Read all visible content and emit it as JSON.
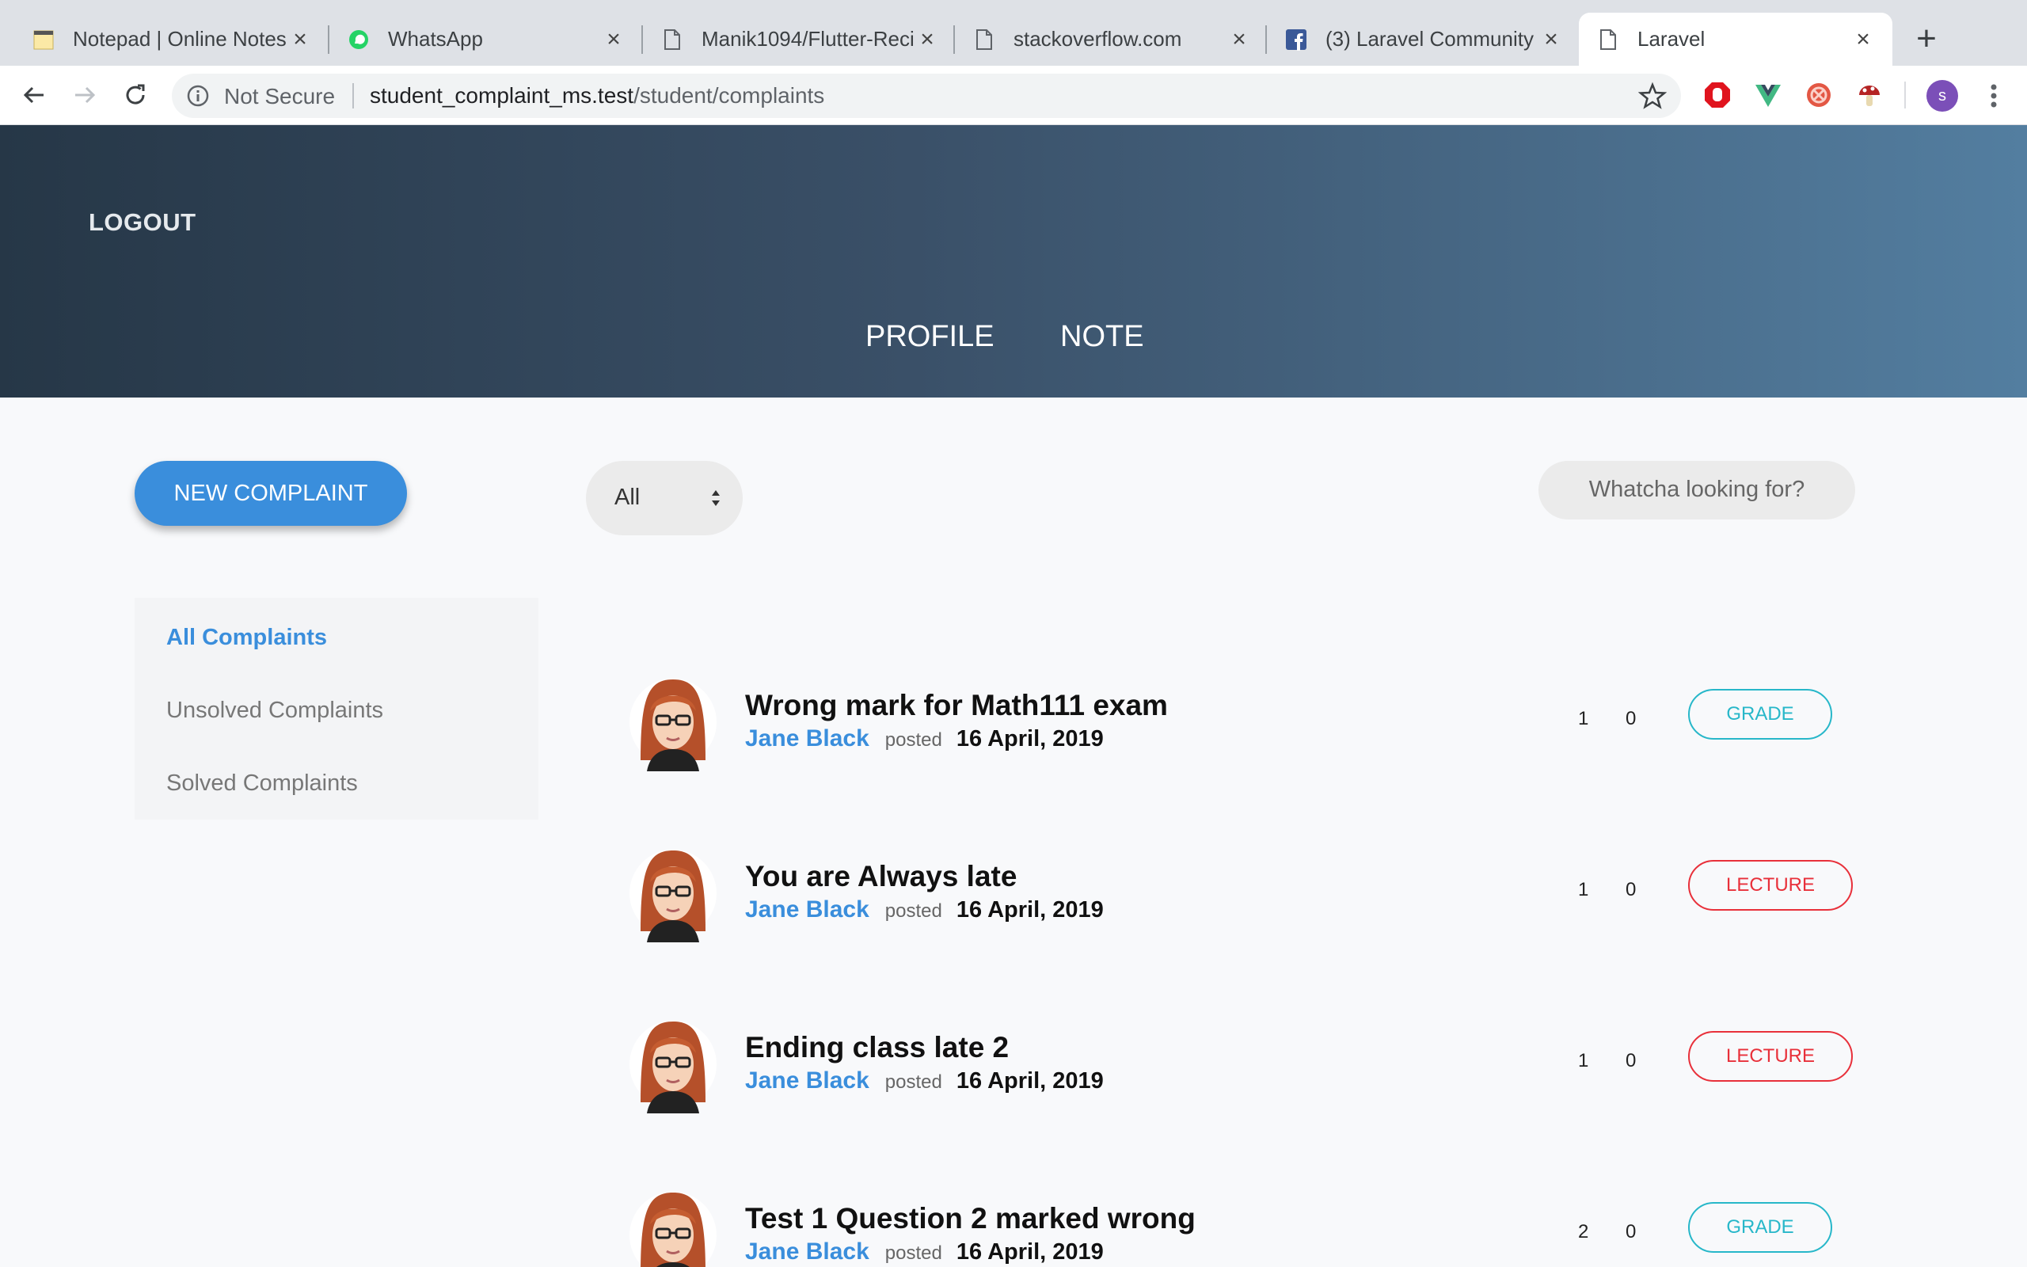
{
  "browser": {
    "tabs": [
      {
        "title": "Notepad | Online Notes",
        "icon": "notepad-icon"
      },
      {
        "title": "WhatsApp",
        "icon": "whatsapp-icon"
      },
      {
        "title": "Manik1094/Flutter-Reci",
        "icon": "page-icon"
      },
      {
        "title": "stackoverflow.com",
        "icon": "page-icon"
      },
      {
        "title": "(3) Laravel Community",
        "icon": "facebook-icon"
      },
      {
        "title": "Laravel",
        "icon": "page-icon"
      }
    ],
    "address": {
      "security_label": "Not Secure",
      "url_host": "student_complaint_ms.test",
      "url_path": "/student/complaints"
    },
    "profile_initial": "s"
  },
  "header": {
    "logout_label": "LOGOUT",
    "nav": {
      "profile": "PROFILE",
      "note": "NOTE"
    }
  },
  "controls": {
    "new_complaint_label": "NEW COMPLAINT",
    "filter_value": "All",
    "search_placeholder": "Whatcha looking for?"
  },
  "sidebar": {
    "items": [
      {
        "label": "All Complaints",
        "active": true
      },
      {
        "label": "Unsolved Complaints",
        "active": false
      },
      {
        "label": "Solved Complaints",
        "active": false
      }
    ]
  },
  "complaints": [
    {
      "title": "Wrong mark for Math111 exam",
      "author": "Jane Black",
      "posted": "posted",
      "date": "16 April, 2019",
      "count1": "1",
      "count2": "0",
      "category": "GRADE"
    },
    {
      "title": "You are Always late",
      "author": "Jane Black",
      "posted": "posted",
      "date": "16 April, 2019",
      "count1": "1",
      "count2": "0",
      "category": "LECTURE"
    },
    {
      "title": "Ending class late 2",
      "author": "Jane Black",
      "posted": "posted",
      "date": "16 April, 2019",
      "count1": "1",
      "count2": "0",
      "category": "LECTURE"
    },
    {
      "title": "Test 1 Question 2 marked wrong",
      "author": "Jane Black",
      "posted": "posted",
      "date": "16 April, 2019",
      "count1": "2",
      "count2": "0",
      "category": "GRADE"
    }
  ],
  "colors": {
    "accent": "#3a8edc",
    "grade": "#27b7c9",
    "lecture": "#e8303a",
    "header_start": "#263747",
    "header_end": "#537ea0"
  }
}
